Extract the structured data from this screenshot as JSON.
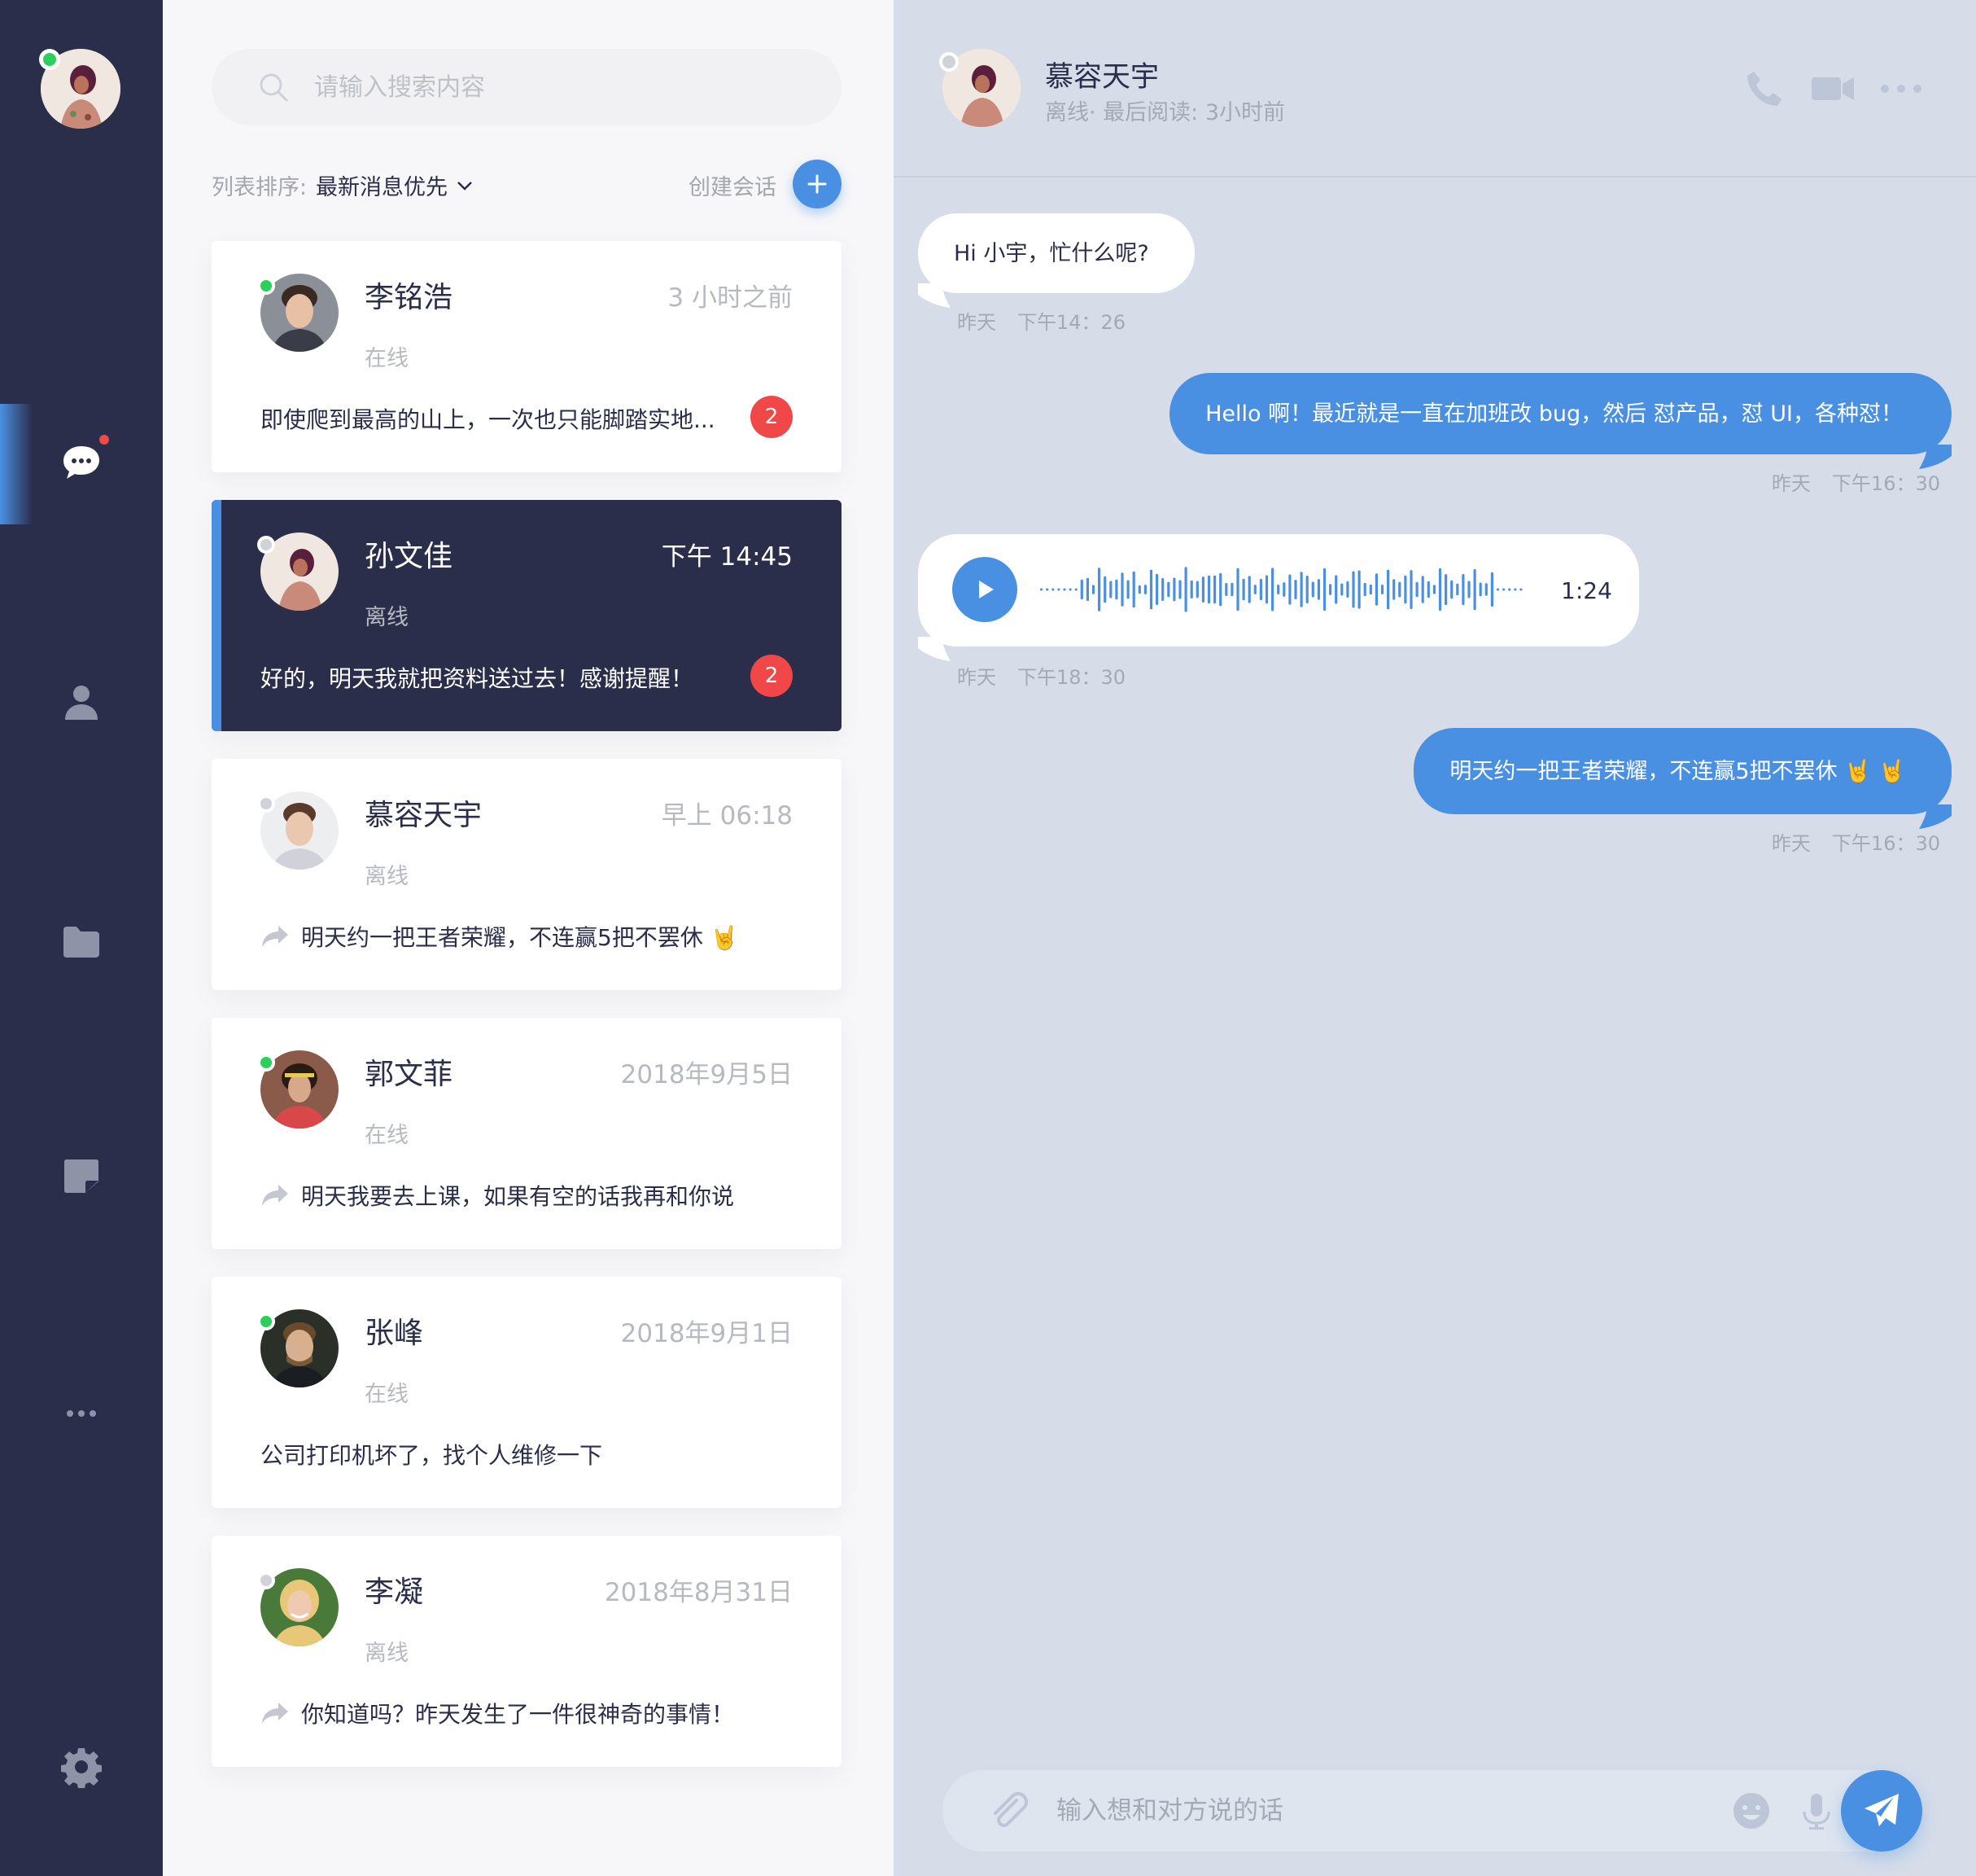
{
  "sidebar": {
    "nav": [
      "chat-icon",
      "user-icon",
      "folder-icon",
      "note-icon",
      "more-icon",
      "gear-icon"
    ]
  },
  "list": {
    "search_placeholder": "请输入搜索内容",
    "sort_label": "列表排序:",
    "sort_value": "最新消息优先",
    "create_label": "创建会话",
    "conversations": [
      {
        "name": "李铭浩",
        "time": "3 小时之前",
        "status": "在线",
        "message": "即使爬到最高的山上，一次也只能脚踏实地...",
        "badge": "2",
        "online": true,
        "forwarded": false
      },
      {
        "name": "孙文佳",
        "time": "下午 14:45",
        "status": "离线",
        "message": "好的，明天我就把资料送过去！感谢提醒！",
        "badge": "2",
        "online": false,
        "forwarded": false
      },
      {
        "name": "慕容天宇",
        "time": "早上 06:18",
        "status": "离线",
        "message": "明天约一把王者荣耀，不连赢5把不罢休 🤘",
        "badge": "",
        "online": false,
        "forwarded": true
      },
      {
        "name": "郭文菲",
        "time": "2018年9月5日",
        "status": "在线",
        "message": "明天我要去上课，如果有空的话我再和你说",
        "badge": "",
        "online": true,
        "forwarded": true
      },
      {
        "name": "张峰",
        "time": "2018年9月1日",
        "status": "在线",
        "message": "公司打印机坏了，找个人维修一下",
        "badge": "",
        "online": true,
        "forwarded": false
      },
      {
        "name": "李凝",
        "time": "2018年8月31日",
        "status": "离线",
        "message": "你知道吗？昨天发生了一件很神奇的事情！",
        "badge": "",
        "online": false,
        "forwarded": true
      }
    ]
  },
  "chat": {
    "name": "慕容天宇",
    "subtitle": "离线· 最后阅读: 3小时前",
    "messages": [
      {
        "direction": "in",
        "text": "Hi 小宇，忙什么呢?",
        "day": "昨天",
        "time": "下午14：26"
      },
      {
        "direction": "out",
        "text": "Hello 啊！最近就是一直在加班改 bug，然后 怼产品，怼 UI，各种怼！",
        "day": "昨天",
        "time": "下午16：30"
      },
      {
        "direction": "in",
        "type": "voice",
        "duration": "1:24",
        "day": "昨天",
        "time": "下午18：30"
      },
      {
        "direction": "out",
        "text": "明天约一把王者荣耀，不连赢5把不罢休 🤘 🤘",
        "day": "昨天",
        "time": "下午16：30"
      }
    ],
    "composer_placeholder": "输入想和对方说的话"
  },
  "colors": {
    "sidebar": "#2b2e4a",
    "accent": "#4a90e2",
    "chat_bg": "#d6dde9",
    "badge": "#f04848",
    "online": "#2bcf5a"
  }
}
